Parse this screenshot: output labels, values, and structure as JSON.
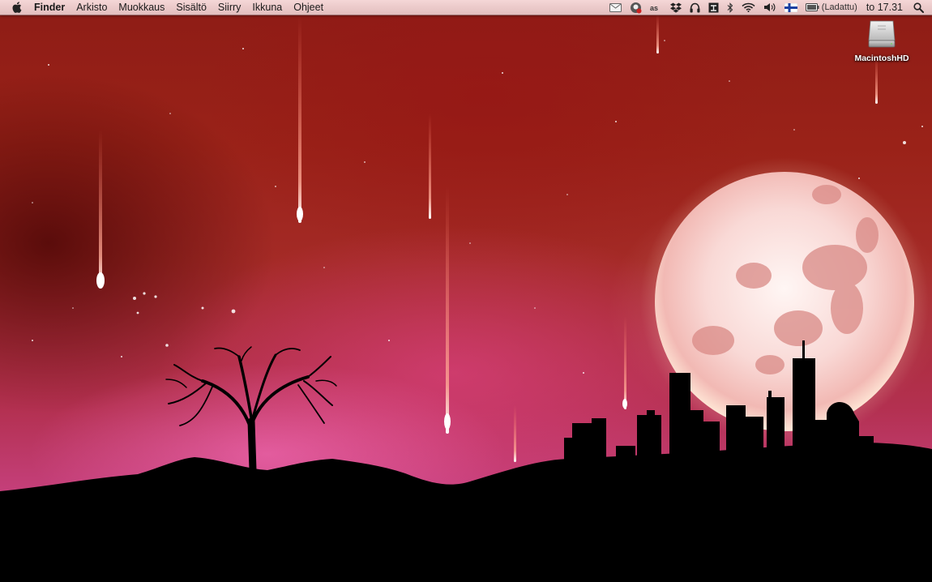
{
  "menubar": {
    "apple_icon": "apple-logo-icon",
    "app_name": "Finder",
    "items": [
      "Arkisto",
      "Muokkaus",
      "Sisältö",
      "Siirry",
      "Ikkuna",
      "Ohjeet"
    ],
    "status_icons": [
      "mail-icon",
      "skype-icon",
      "lastfm-icon",
      "dropbox-icon",
      "headphones-icon",
      "tool-icon",
      "bluetooth-icon",
      "wifi-icon",
      "volume-icon",
      "finnish-flag-icon",
      "battery-icon",
      "spotlight-icon"
    ],
    "battery_status": "(Ladattu)",
    "clock": "to 17.31"
  },
  "desktop": {
    "icons": [
      {
        "label": "MacintoshHD",
        "icon": "hard-drive-icon"
      }
    ]
  }
}
